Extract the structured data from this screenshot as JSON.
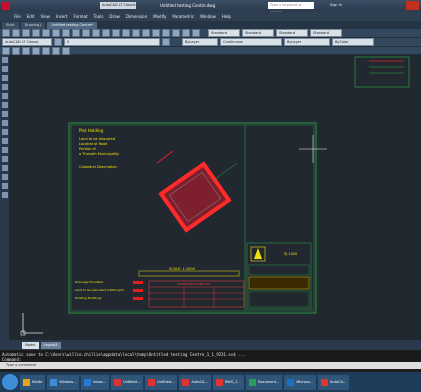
{
  "app": {
    "title": "Untitled testing Centre.dwg",
    "workspace": "AutoCAD LT Classic",
    "search_placeholder": "Type a keyword or phrase",
    "signin": "Sign In"
  },
  "menu": [
    "File",
    "Edit",
    "View",
    "Insert",
    "Format",
    "Tools",
    "Draw",
    "Dimension",
    "Modify",
    "Parametric",
    "Window",
    "Help"
  ],
  "tabs": [
    "Start",
    "Drawing1",
    "Untitled testing Centre*"
  ],
  "styles": {
    "text_style": "Standard",
    "dim_style": "Standard",
    "table_style": "Standard",
    "ml_style": "Standard",
    "layer": "0",
    "color": "ByLayer",
    "linetype": "Continuous",
    "lineweight": "ByLayer",
    "plotstyle": "ByColor"
  },
  "drawing": {
    "plot_heading": "Plot Holding",
    "plot_lines": [
      "Land to be Allocated",
      "Located at Road",
      "Portion of",
      "a Thohoth Municipality"
    ],
    "cadastral_heading": "Cadastral Description",
    "scale_text": "SCALE: 1:1000",
    "schedule_title": "TOWNSHIP SCHEDULE",
    "legend": [
      "Drainage Floodline",
      "Land to be Allocated (1000 sqm)",
      "Existing Buildings"
    ],
    "drawing_number": "SJ 1000"
  },
  "layout_tabs": [
    "Model",
    "Layout1"
  ],
  "console": {
    "line1": "Automatic save to C:\\Users\\willie.chillie\\appdata\\local\\temp\\Untitled testing Centre_1_1_9231.sv$ ...",
    "line2": "Command:",
    "input_placeholder": "Type a command"
  },
  "taskbar": [
    "Ninite",
    "Window...",
    "Inbox...",
    "Untitled...",
    "Untitled...",
    "AutoCA...",
    "DWG_1...",
    "Document...",
    "Microso...",
    "AutoCA..."
  ],
  "colors": {
    "canvas": "#212830",
    "border": "#2eaf46",
    "plot": "#e61c22",
    "text_yellow": "#f2e20c",
    "text_green": "#2fd84e",
    "text_red": "#ff4040"
  }
}
